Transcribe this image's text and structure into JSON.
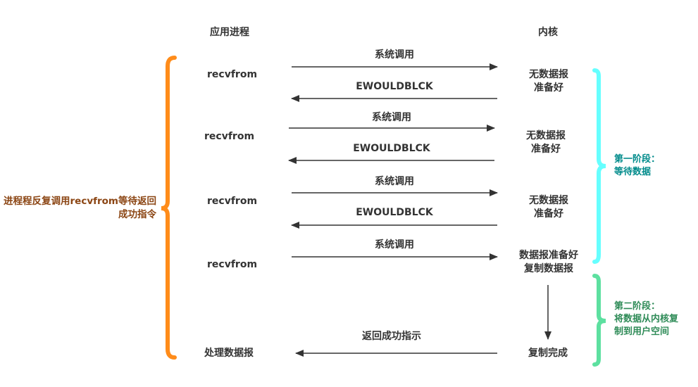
{
  "headers": {
    "app": "应用进程",
    "kernel": "内核"
  },
  "left_note": {
    "line1": "进程程反复调用recvfrom等待返回",
    "line2": "成功指令",
    "color": "#8B4513"
  },
  "rounds": [
    {
      "app": "recvfrom",
      "call": "系统调用",
      "reply": "EWOULDBLCK",
      "kernel_l1": "无数据报",
      "kernel_l2": "准备好"
    },
    {
      "app": "recvfrom",
      "call": "系统调用",
      "reply": "EWOULDBLCK",
      "kernel_l1": "无数据报",
      "kernel_l2": "准备好"
    },
    {
      "app": "recvfrom",
      "call": "系统调用",
      "reply": "EWOULDBLCK",
      "kernel_l1": "无数据报",
      "kernel_l2": "准备好"
    }
  ],
  "last_round": {
    "app": "recvfrom",
    "call": "系统调用",
    "kernel_l1": "数据报准备好",
    "kernel_l2": "复制数据报"
  },
  "finish": {
    "app": "处理数据报",
    "reply": "返回成功指示",
    "kernel": "复制完成"
  },
  "phase1": {
    "line1": "第一阶段：",
    "line2": "等待数据",
    "color": "#008B8B",
    "brace_color": "#66FFFF"
  },
  "phase2": {
    "line1": "第二阶段：",
    "line2": "将数据从内核复",
    "line3": "制到用户空间",
    "color": "#2E8B57",
    "brace_color": "#5DE0A0"
  },
  "colors": {
    "left_brace": "#FF8C1A",
    "arrow": "#333333"
  }
}
